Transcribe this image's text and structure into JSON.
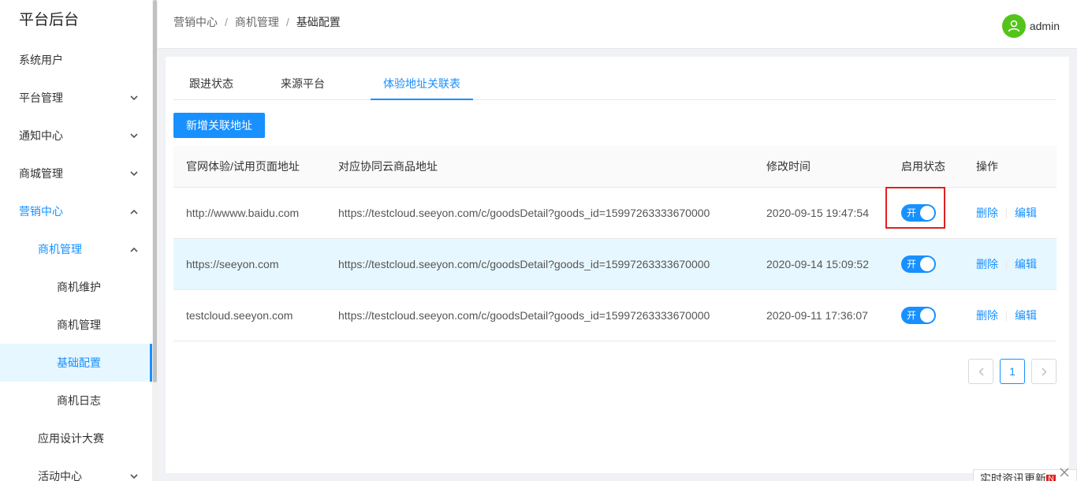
{
  "app": {
    "title": "平台后台"
  },
  "sidebar": {
    "items": [
      {
        "label": "系统用户"
      },
      {
        "label": "平台管理"
      },
      {
        "label": "通知中心"
      },
      {
        "label": "商城管理"
      },
      {
        "label": "营销中心"
      },
      {
        "label": "商机管理"
      },
      {
        "label": "商机维护"
      },
      {
        "label": "商机管理"
      },
      {
        "label": "基础配置"
      },
      {
        "label": "商机日志"
      },
      {
        "label": "应用设计大赛"
      },
      {
        "label": "活动中心"
      }
    ]
  },
  "breadcrumb": [
    "营销中心",
    "商机管理",
    "基础配置"
  ],
  "breadcrumb_sep": "/",
  "user": {
    "name": "admin"
  },
  "tabs": [
    {
      "label": "跟进状态"
    },
    {
      "label": "来源平台"
    },
    {
      "label": "体验地址关联表"
    }
  ],
  "add_button": "新增关联地址",
  "table": {
    "headers": [
      "官网体验/试用页面地址",
      "对应协同云商品地址",
      "修改时间",
      "启用状态",
      "操作"
    ],
    "rows": [
      {
        "page_url": "http://wwww.baidu.com",
        "goods_url": "https://testcloud.seeyon.com/c/goodsDetail?goods_id=15997263333670000",
        "time": "2020-09-15 19:47:54",
        "status": "开",
        "delete": "删除",
        "edit": "编辑"
      },
      {
        "page_url": "https://seeyon.com",
        "goods_url": "https://testcloud.seeyon.com/c/goodsDetail?goods_id=15997263333670000",
        "time": "2020-09-14 15:09:52",
        "status": "开",
        "delete": "删除",
        "edit": "编辑"
      },
      {
        "page_url": "testcloud.seeyon.com",
        "goods_url": "https://testcloud.seeyon.com/c/goodsDetail?goods_id=15997263333670000",
        "time": "2020-09-11 17:36:07",
        "status": "开",
        "delete": "删除",
        "edit": "编辑"
      }
    ]
  },
  "pagination": {
    "current": "1"
  },
  "notice": {
    "text": "实时资讯更新",
    "badge": "N"
  },
  "colors": {
    "accent": "#1890ff",
    "avatar": "#52c41a",
    "highlight": "#e02020",
    "row_hover": "#e6f7ff"
  }
}
